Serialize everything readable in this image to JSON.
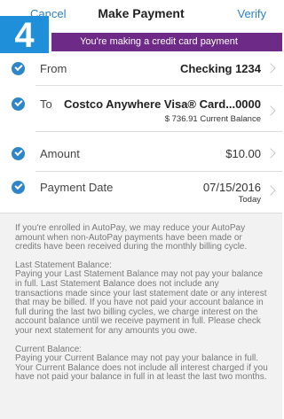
{
  "nav": {
    "cancel_label": "Cancel",
    "title": "Make Payment",
    "verify_label": "Verify"
  },
  "step_badge": "4",
  "banner": "You're making a credit card payment",
  "rows": {
    "from": {
      "label": "From",
      "value": "Checking 1234"
    },
    "to": {
      "label": "To",
      "value": "Costco Anywhere Visa® Card...0000",
      "sub_value": "$ 736.91 Current Balance"
    },
    "amount": {
      "label": "Amount",
      "value": "$10.00"
    },
    "date": {
      "label": "Payment Date",
      "value": "07/15/2016",
      "sub_value": "Today"
    }
  },
  "info": {
    "autopay": "If you're enrolled in AutoPay, we may reduce your AutoPay amount when non-AutoPay payments have been made or credits have been received during the monthly billing cycle.",
    "last_statement_title": "Last Statement Balance:",
    "last_statement_body": "Paying your Last Statement Balance may not pay your balance in full. Last Statement Balance does not include any transactions made since your last statement date or any interest that may be billed. If you have not paid your account balance in full during the last two billing cycles, we charge interest on the account balance until we receive payment in full. Please check your next statement for any amounts you owe.",
    "current_title": "Current Balance:",
    "current_body": "Paying your Current Balance may not pay your balance in full. Your Current Balance does not include all interest charged if you have not paid your balance in full in at least the last two months."
  },
  "colors": {
    "accent": "#2b7fcc",
    "banner": "#6d2a86",
    "badge": "#1e8fd8",
    "check": "#2e86c9"
  }
}
